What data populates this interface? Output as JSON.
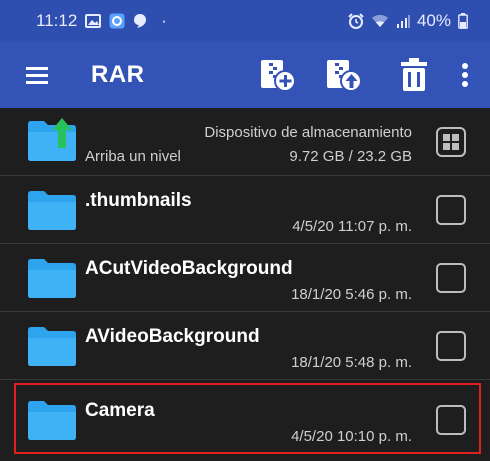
{
  "status_bar": {
    "time": "11:12",
    "dot": "·",
    "battery": "40%",
    "icons": [
      "gallery-icon",
      "app-notification-icon",
      "chat-icon",
      "alarm-icon",
      "wifi-icon",
      "signal-icon",
      "battery-icon"
    ]
  },
  "app_bar": {
    "title": "RAR",
    "actions": [
      "menu-icon",
      "archive-add-icon",
      "archive-extract-icon",
      "delete-icon",
      "more-options-icon"
    ]
  },
  "up_row": {
    "label": "Arriba un nivel",
    "storage_title": "Dispositivo de almacenamiento",
    "storage_usage": "9.72 GB / 23.2 GB"
  },
  "files": [
    {
      "name": ".thumbnails",
      "date": "4/5/20 11:07 p. m.",
      "checked": false
    },
    {
      "name": "ACutVideoBackground",
      "date": "18/1/20 5:46 p. m.",
      "checked": false
    },
    {
      "name": "AVideoBackground",
      "date": "18/1/20 5:48 p. m.",
      "checked": false
    },
    {
      "name": "Camera",
      "date": "4/5/20 10:10 p. m.",
      "checked": false,
      "highlighted": true
    }
  ],
  "colors": {
    "status_bar": "#2f4fb0",
    "app_bar": "#3453b6",
    "background": "#1e1e1e",
    "folder": "#2ea3ee",
    "up_arrow": "#27c25c",
    "highlight": "#e0201c"
  }
}
